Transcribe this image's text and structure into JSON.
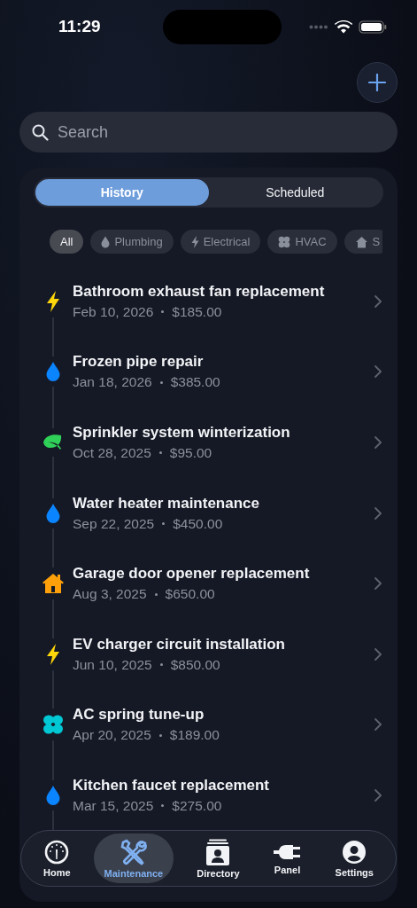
{
  "status_bar": {
    "time": "11:29"
  },
  "search": {
    "placeholder": "Search"
  },
  "segments": [
    {
      "label": "History",
      "selected": true
    },
    {
      "label": "Scheduled",
      "selected": false
    }
  ],
  "filters": [
    {
      "label": "All",
      "kind": "none",
      "selected": true
    },
    {
      "label": "Plumbing",
      "kind": "drop",
      "selected": false
    },
    {
      "label": "Electrical",
      "kind": "bolt",
      "selected": false
    },
    {
      "label": "HVAC",
      "kind": "fan",
      "selected": false
    },
    {
      "label": "S",
      "kind": "house",
      "selected": false
    }
  ],
  "records": [
    {
      "title": "Bathroom exhaust fan replacement",
      "date": "Feb 10, 2026",
      "cost": "$185.00",
      "kind": "bolt"
    },
    {
      "title": "Frozen pipe repair",
      "date": "Jan 18, 2026",
      "cost": "$385.00",
      "kind": "drop"
    },
    {
      "title": "Sprinkler system winterization",
      "date": "Oct 28, 2025",
      "cost": "$95.00",
      "kind": "leaf"
    },
    {
      "title": "Water heater maintenance",
      "date": "Sep 22, 2025",
      "cost": "$450.00",
      "kind": "drop"
    },
    {
      "title": "Garage door opener replacement",
      "date": "Aug 3, 2025",
      "cost": "$650.00",
      "kind": "house"
    },
    {
      "title": "EV charger circuit installation",
      "date": "Jun 10, 2025",
      "cost": "$850.00",
      "kind": "bolt"
    },
    {
      "title": "AC spring tune-up",
      "date": "Apr 20, 2025",
      "cost": "$189.00",
      "kind": "fan"
    },
    {
      "title": "Kitchen faucet replacement",
      "date": "Mar 15, 2025",
      "cost": "$275.00",
      "kind": "drop"
    }
  ],
  "tab_bar": [
    {
      "label": "Home",
      "kind": "gauge",
      "selected": false
    },
    {
      "label": "Maintenance",
      "kind": "tools",
      "selected": true
    },
    {
      "label": "Directory",
      "kind": "contact",
      "selected": false
    },
    {
      "label": "Panel",
      "kind": "plug",
      "selected": false
    },
    {
      "label": "Settings",
      "kind": "person",
      "selected": false
    }
  ]
}
